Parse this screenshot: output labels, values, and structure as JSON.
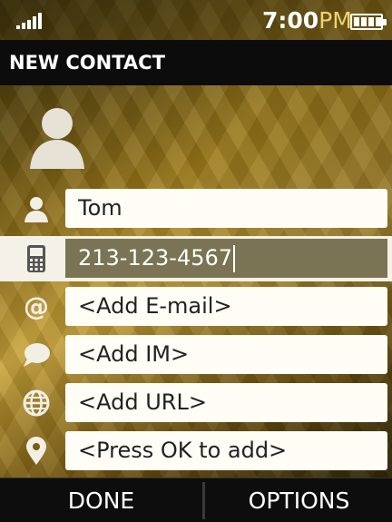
{
  "status": {
    "time": "7:00",
    "ampm": "PM"
  },
  "header": {
    "title": "NEW CONTACT"
  },
  "fields": [
    {
      "name": "name",
      "icon": "person-icon",
      "value": "Tom"
    },
    {
      "name": "phone",
      "icon": "phone-icon",
      "value": "213-123-4567"
    },
    {
      "name": "email",
      "icon": "at-icon",
      "value": "<Add E-mail>"
    },
    {
      "name": "im",
      "icon": "chat-bubble-icon",
      "value": "<Add IM>"
    },
    {
      "name": "url",
      "icon": "globe-icon",
      "value": "<Add URL>"
    },
    {
      "name": "location",
      "icon": "location-pin-icon",
      "value": "<Press OK to add>"
    }
  ],
  "softkeys": {
    "left": "DONE",
    "right": "OPTIONS"
  }
}
